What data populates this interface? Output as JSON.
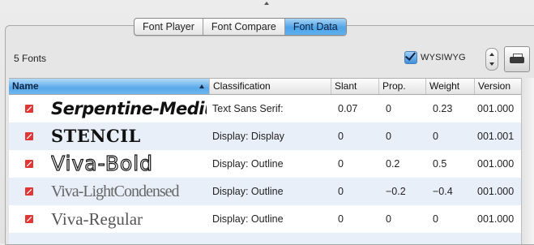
{
  "tabs": [
    {
      "label": "Font Player",
      "active": false
    },
    {
      "label": "Font Compare",
      "active": false
    },
    {
      "label": "Font Data",
      "active": true
    }
  ],
  "toolbar": {
    "font_count": "5 Fonts",
    "wysiwyg_label": "WYSIWYG",
    "wysiwyg_checked": true
  },
  "table": {
    "columns": [
      "Name",
      "Classification",
      "Slant",
      "Prop.",
      "Weight",
      "Version"
    ],
    "sorted_column": "Name",
    "sort_direction": "ascending",
    "rows": [
      {
        "name": "Serpentine-Medium",
        "classification": "Text Sans Serif:",
        "slant": "0.07",
        "prop": "0",
        "weight": "0.23",
        "version": "001.000"
      },
      {
        "name": "STENCIL",
        "classification": "Display: Display",
        "slant": "0",
        "prop": "0",
        "weight": "0",
        "version": "001.001"
      },
      {
        "name": "Viva-Bold",
        "classification": "Display: Outline",
        "slant": "0",
        "prop": "0.2",
        "weight": "0.5",
        "version": "001.000"
      },
      {
        "name": "Viva-LightCondensed",
        "classification": "Display: Outline",
        "slant": "0",
        "prop": "−0.2",
        "weight": "−0.4",
        "version": "001.000"
      },
      {
        "name": "Viva-Regular",
        "classification": "Display: Outline",
        "slant": "0",
        "prop": "0",
        "weight": "0",
        "version": "001.000"
      }
    ]
  },
  "colors": {
    "accent": "#4fa3e8",
    "font_icon": "#e03636",
    "alt_row": "#e8eff8"
  },
  "icons": {
    "font_file": "font-file-icon",
    "print": "printer-icon",
    "sort": "sort-ascending-icon"
  }
}
